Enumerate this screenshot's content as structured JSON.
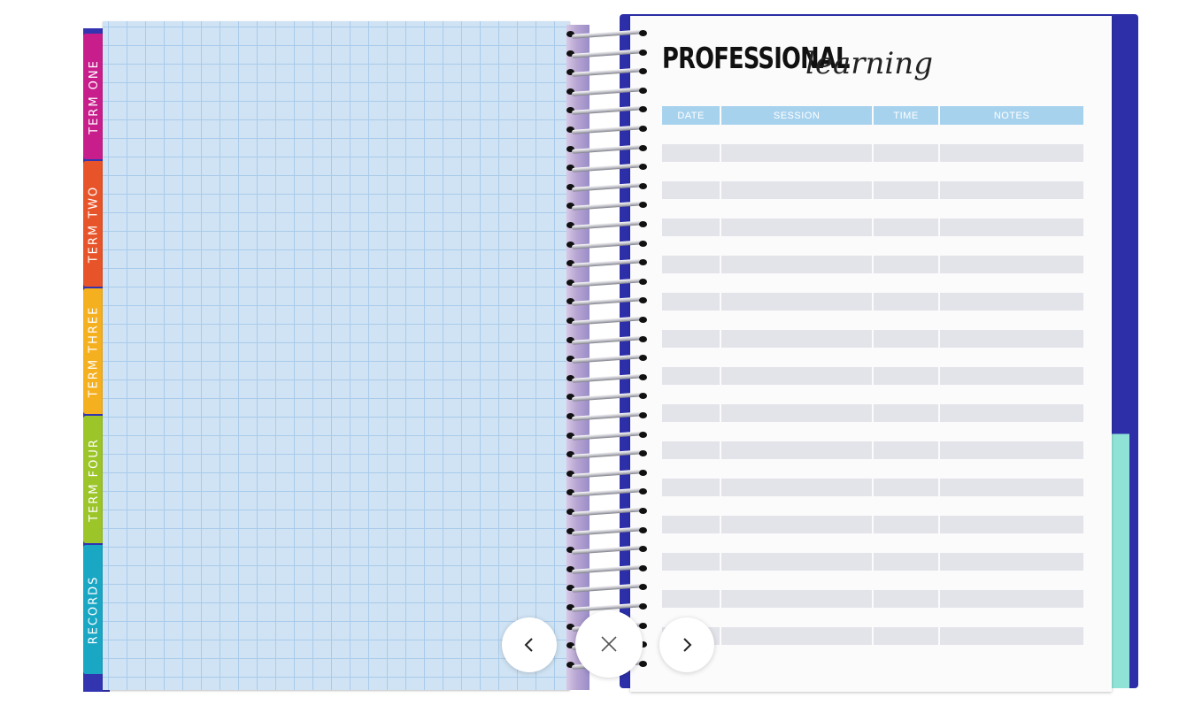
{
  "planner": {
    "title_bold": "PROFESSIONAL",
    "title_script": "learning",
    "table": {
      "headers": [
        "DATE",
        "SESSION",
        "TIME",
        "NOTES"
      ],
      "row_count": 14
    }
  },
  "tabs": [
    {
      "label": "TERM ONE",
      "color": "#c81e8c"
    },
    {
      "label": "TERM TWO",
      "color": "#e8542a"
    },
    {
      "label": "TERM THREE",
      "color": "#f5b020"
    },
    {
      "label": "TERM FOUR",
      "color": "#9cc52a"
    },
    {
      "label": "RECORDS",
      "color": "#1aa7c4"
    }
  ],
  "controls": {
    "previous": "chevron-left-icon",
    "close": "close-icon",
    "next": "chevron-right-icon"
  },
  "colors": {
    "header_blue": "#a7d2ee",
    "row_gray": "#e3e3ea",
    "grid_paper": "#cfe3f4",
    "cover_navy": "#2c2fa8"
  }
}
